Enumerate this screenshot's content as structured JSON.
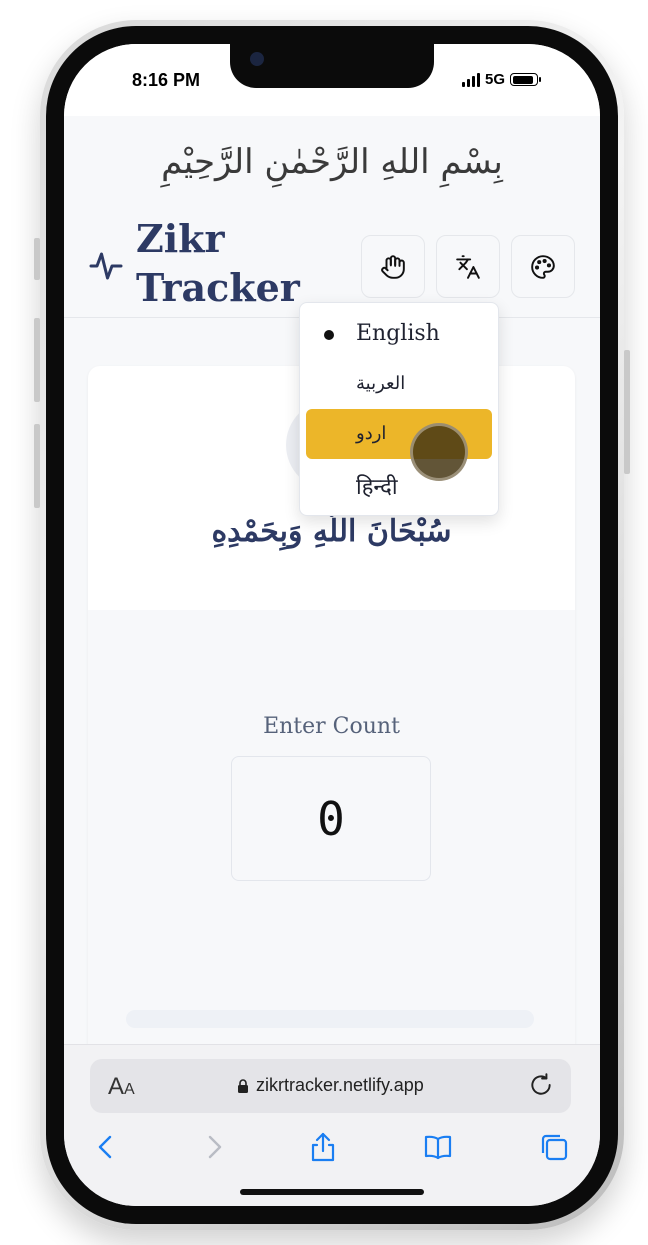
{
  "status_bar": {
    "time": "8:16 PM",
    "network": "5G"
  },
  "header": {
    "bismillah": "بِسْمِ اللهِ الرَّحْمٰنِ الرَّحِيْمِ",
    "brand_line1": "Zikr",
    "brand_line2": "Tracker",
    "buttons": [
      {
        "name": "tap-mode",
        "icon": "hand-icon"
      },
      {
        "name": "language",
        "icon": "translate-icon"
      },
      {
        "name": "theme",
        "icon": "palette-icon"
      }
    ]
  },
  "card": {
    "dhikr": "سُبْحَانَ اللَّهِ وَبِحَمْدِهِ",
    "count_label": "Enter Count",
    "count_value": "0"
  },
  "language_menu": {
    "items": [
      {
        "label": "English",
        "selected": true,
        "highlighted": false
      },
      {
        "label": "العربية",
        "selected": false,
        "highlighted": false
      },
      {
        "label": "اردو",
        "selected": false,
        "highlighted": true
      },
      {
        "label": "हिन्दी",
        "selected": false,
        "highlighted": false
      }
    ]
  },
  "browser": {
    "aa_big": "A",
    "aa_small": "A",
    "url": "zikrtracker.netlify.app"
  },
  "colors": {
    "brand": "#2d3a64",
    "highlight": "#ecb629",
    "background": "#f7f8fa",
    "ios_blue": "#1a7ef2"
  }
}
